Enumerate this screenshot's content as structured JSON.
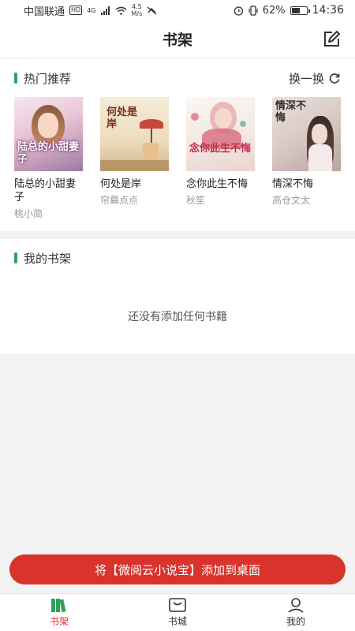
{
  "status": {
    "carrier": "中国联通",
    "hd": "HD",
    "net": "4G",
    "speed_value": "4.5",
    "speed_unit": "M/s",
    "battery": "62%",
    "battery_level": 0.62,
    "time": "14:36"
  },
  "header": {
    "title": "书架"
  },
  "hot": {
    "title": "热门推荐",
    "refresh_label": "换一换",
    "books": [
      {
        "title": "陆总的小甜妻子",
        "author": "桃小简",
        "cover_text": "陆总的小甜妻子"
      },
      {
        "title": "何处是岸",
        "author": "帘幕点点",
        "cover_text": "何处是岸"
      },
      {
        "title": "念你此生不悔",
        "author": "秋笙",
        "cover_text": "念你此生不悔"
      },
      {
        "title": "情深不悔",
        "author": "高仓文太",
        "cover_text": "情深不悔"
      }
    ]
  },
  "shelf": {
    "title": "我的书架",
    "empty_text": "还没有添加任何书籍"
  },
  "add_button": {
    "label": "将【微阅云小说宝】添加到桌面"
  },
  "tabs": [
    {
      "label": "书架",
      "active": true
    },
    {
      "label": "书城",
      "active": false
    },
    {
      "label": "我的",
      "active": false
    }
  ],
  "colors": {
    "accent": "#d8332c",
    "green_mark": "#2fa15a"
  }
}
